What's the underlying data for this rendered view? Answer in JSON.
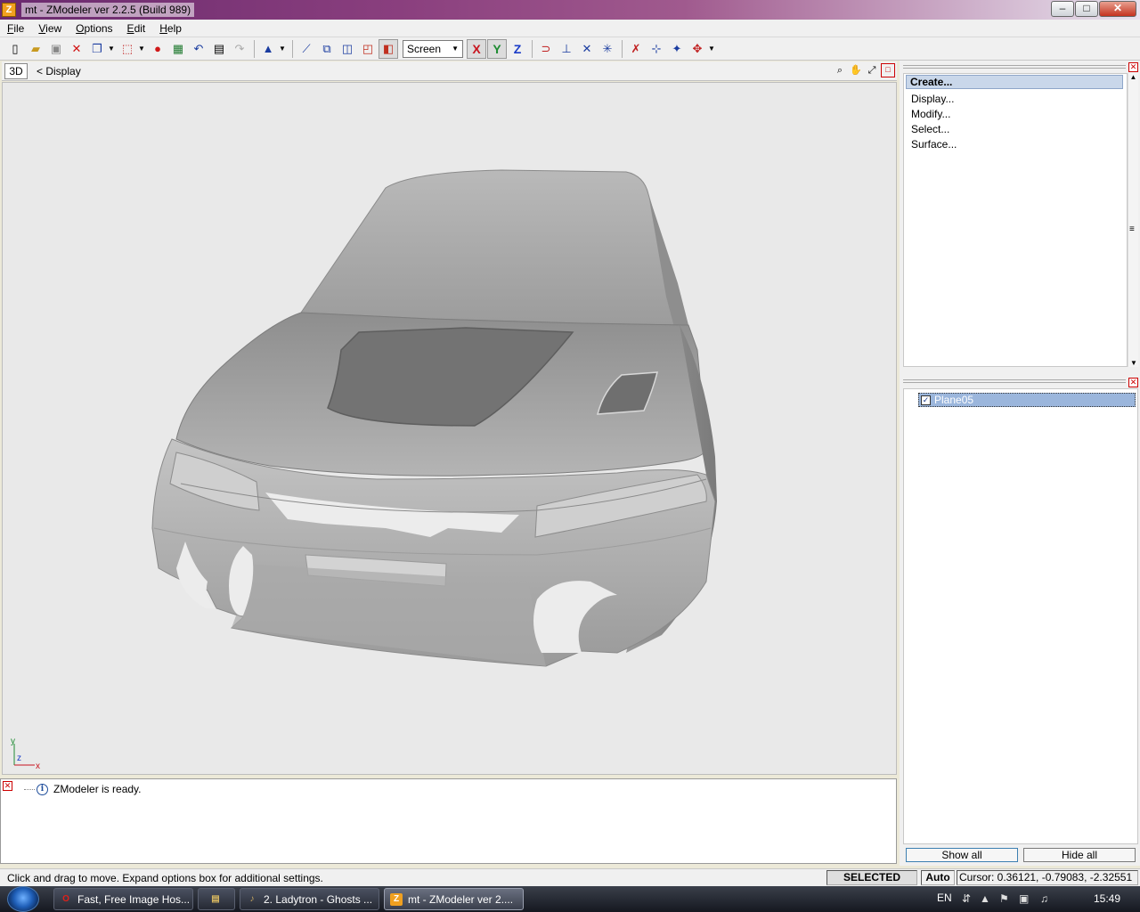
{
  "window": {
    "title": "mt - ZModeler ver 2.2.5 (Build 989)",
    "app_icon_letter": "Z",
    "controls": {
      "minimize": "–",
      "maximize": "□",
      "close": "✕"
    }
  },
  "menu": [
    "File",
    "View",
    "Options",
    "Edit",
    "Help"
  ],
  "toolbar": {
    "coord_select": "Screen",
    "axes": [
      {
        "label": "X",
        "color": "#c8141e",
        "pressed": true
      },
      {
        "label": "Y",
        "color": "#1e8c32",
        "pressed": true
      },
      {
        "label": "Z",
        "color": "#1a3cc8",
        "pressed": false
      }
    ]
  },
  "viewport": {
    "mode_label": "3D",
    "title": "<  Display",
    "axis_gizmo": {
      "y": "y",
      "z": "z",
      "x": "x"
    }
  },
  "log": {
    "icon": "i",
    "message": "ZModeler is ready."
  },
  "command_panel": {
    "active": "Create...",
    "items": [
      "Display...",
      "Modify...",
      "Select...",
      "Surface..."
    ]
  },
  "objects": {
    "items": [
      {
        "name": "Plane05",
        "checked": "✓"
      }
    ],
    "show_all": "Show all",
    "hide_all": "Hide all"
  },
  "status": {
    "hint": "Click and drag to move. Expand options box for additional settings.",
    "mode": "SELECTED MODE",
    "auto": "Auto",
    "cursor": "Cursor: 0.36121, -0.79083, -2.32551"
  },
  "taskbar": {
    "tasks": [
      {
        "label": "Fast, Free Image Hos...",
        "icon": "O",
        "icon_color": "#e0201a"
      },
      {
        "label": "",
        "icon": "▤",
        "icon_color": "#d8b860"
      },
      {
        "label": "2. Ladytron - Ghosts ...",
        "icon": "♪",
        "icon_color": "#c8a860"
      },
      {
        "label": "mt - ZModeler ver 2....",
        "icon": "Z",
        "icon_color": "#f0a020"
      }
    ],
    "language": "EN",
    "clock": "15:49"
  }
}
